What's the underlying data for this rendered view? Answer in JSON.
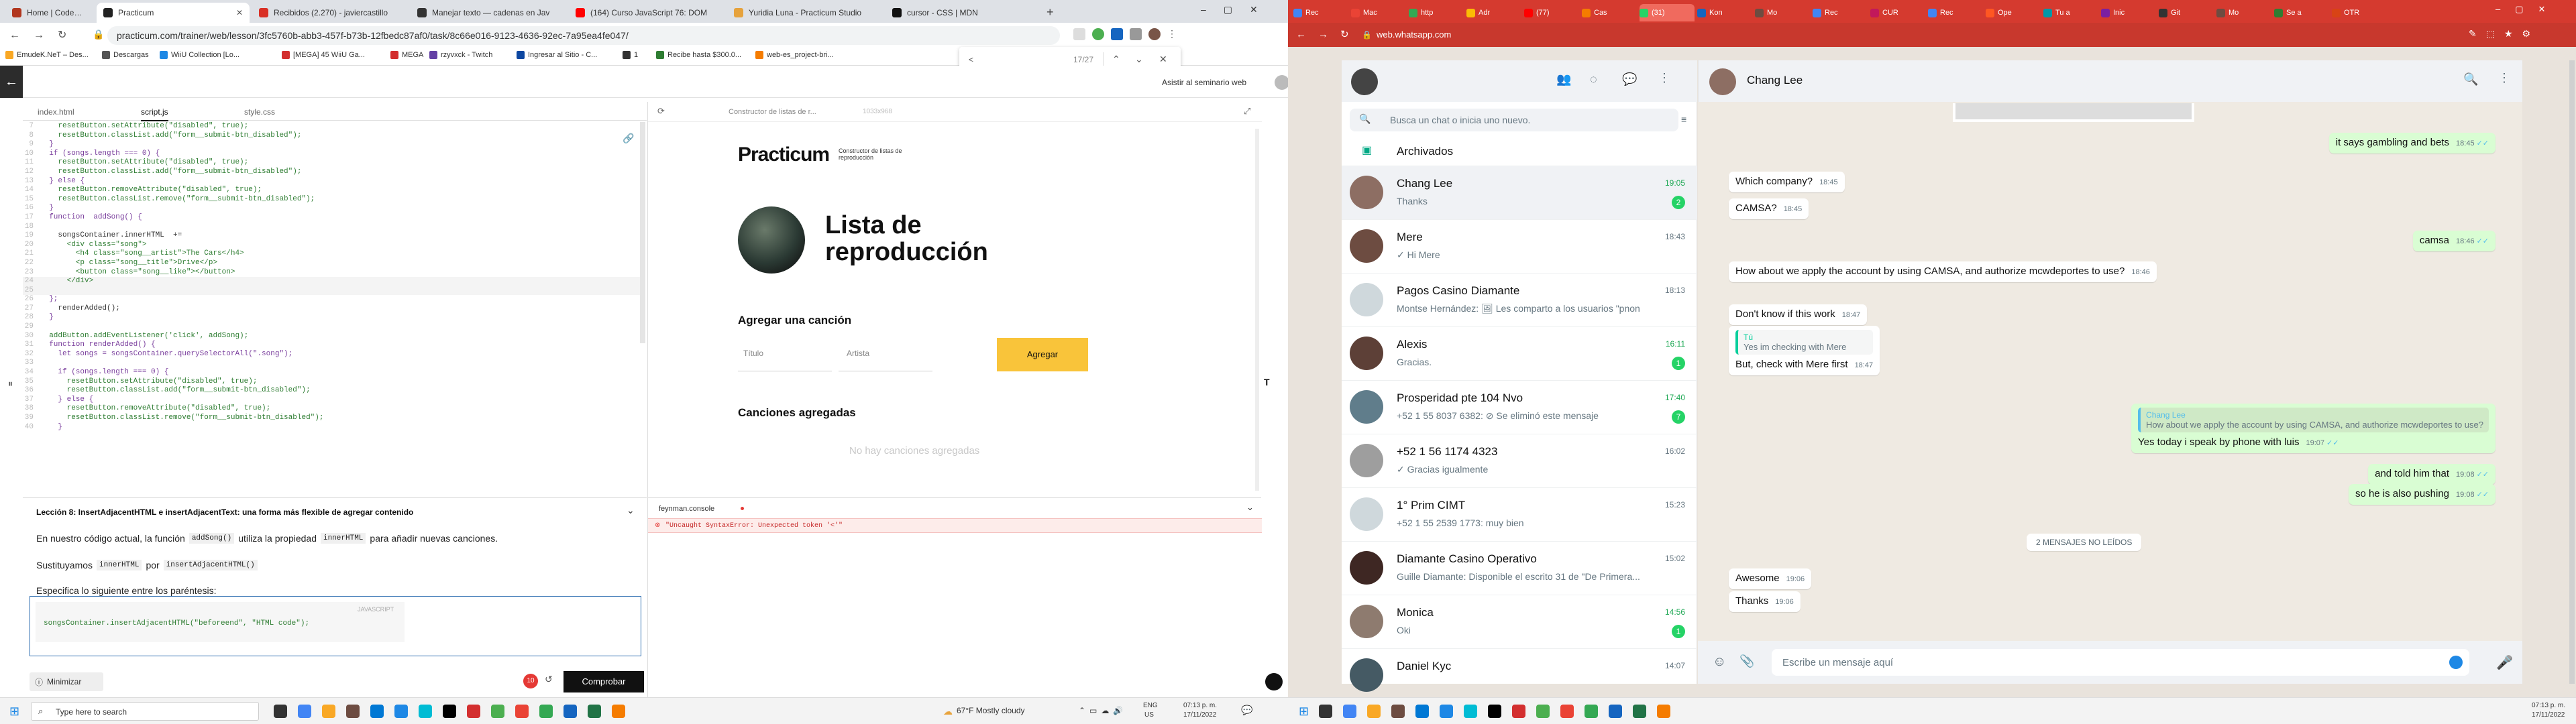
{
  "left_browser": {
    "tabs": [
      {
        "label": "Home | Codewars",
        "color": "#b1361e"
      },
      {
        "label": "Practicum",
        "color": "#222222"
      },
      {
        "label": "Recibidos (2.270) - javiercastillo",
        "color": "#d93025"
      },
      {
        "label": "Manejar texto — cadenas en Jav",
        "color": "#333333"
      },
      {
        "label": "(164) Curso JavaScript 76: DOM",
        "color": "#ff0000"
      },
      {
        "label": "Yuridia Luna - Practicum Studio",
        "color": "#e6a23c"
      },
      {
        "label": "cursor - CSS | MDN",
        "color": "#111111"
      }
    ],
    "url": "practicum.com/trainer/web/lesson/3fc5760b-abb3-457f-b73b-12fbedc87af0/task/8c66e016-9123-4636-92ec-7a95ea4fe047/",
    "bookmarks": [
      "EmudeK.NeT – Des...",
      "Descargas",
      "WiiU Collection [Lo...",
      "[MEGA] 45 WiiU Ga...",
      "MEGA",
      "rzyvxck - Twitch",
      "Ingresar al Sitio - C...",
      "1",
      "Recibe hasta $300.0...",
      "web-es_project-bri..."
    ],
    "find": {
      "query": "<",
      "count": "17/27"
    },
    "assist_link": "Asistir al seminario web",
    "editor_tabs": [
      "index.html",
      "script.js",
      "style.css"
    ],
    "code_lines": [
      {
        "n": "7",
        "t": "    resetButton.setAttribute(\"disabled\", true);"
      },
      {
        "n": "8",
        "t": "    resetButton.classList.add(\"form__submit-btn_disabled\");"
      },
      {
        "n": "9",
        "t": "  }"
      },
      {
        "n": "10",
        "t": "  if (songs.length === 0) {"
      },
      {
        "n": "11",
        "t": "    resetButton.setAttribute(\"disabled\", true);"
      },
      {
        "n": "12",
        "t": "    resetButton.classList.add(\"form__submit-btn_disabled\");"
      },
      {
        "n": "13",
        "t": "  } else {"
      },
      {
        "n": "14",
        "t": "    resetButton.removeAttribute(\"disabled\", true);"
      },
      {
        "n": "15",
        "t": "    resetButton.classList.remove(\"form__submit-btn_disabled\");"
      },
      {
        "n": "16",
        "t": "  }"
      },
      {
        "n": "17",
        "t": "  function  addSong() {"
      },
      {
        "n": "18",
        "t": ""
      },
      {
        "n": "19",
        "t": "    songsContainer.innerHTML  +="
      },
      {
        "n": "20",
        "t": "      <div class=\"song\">"
      },
      {
        "n": "21",
        "t": "        <h4 class=\"song__artist\">The Cars</h4>"
      },
      {
        "n": "22",
        "t": "        <p class=\"song__title\">Drive</p>"
      },
      {
        "n": "23",
        "t": "        <button class=\"song__like\"></button>"
      },
      {
        "n": "24",
        "t": "      </div>"
      },
      {
        "n": "25",
        "t": ""
      },
      {
        "n": "26",
        "t": "  };"
      },
      {
        "n": "27",
        "t": "    renderAdded();"
      },
      {
        "n": "28",
        "t": "  }"
      },
      {
        "n": "29",
        "t": ""
      },
      {
        "n": "30",
        "t": "  addButton.addEventListener('click', addSong);"
      },
      {
        "n": "31",
        "t": "  function renderAdded() {"
      },
      {
        "n": "32",
        "t": "    let songs = songsContainer.querySelectorAll(\".song\");"
      },
      {
        "n": "33",
        "t": ""
      },
      {
        "n": "34",
        "t": "    if (songs.length === 0) {"
      },
      {
        "n": "35",
        "t": "      resetButton.setAttribute(\"disabled\", true);"
      },
      {
        "n": "36",
        "t": "      resetButton.classList.add(\"form__submit-btn_disabled\");"
      },
      {
        "n": "37",
        "t": "    } else {"
      },
      {
        "n": "38",
        "t": "      resetButton.removeAttribute(\"disabled\", true);"
      },
      {
        "n": "39",
        "t": "      resetButton.classList.remove(\"form__submit-btn_disabled\");"
      },
      {
        "n": "40",
        "t": "    }"
      }
    ],
    "preview": {
      "bar_title": "Constructor de listas de r...",
      "bar_id": "1033x968",
      "brand": "Practicum",
      "brand_sub": "Constructor de listas de reproducción",
      "heading_1": "Lista de",
      "heading_2": "reproducción",
      "add_title": "Agregar una canción",
      "ph_title": "Título",
      "ph_artist": "Artista",
      "add_button": "Agregar",
      "added_title": "Canciones agregadas",
      "empty": "No hay canciones agregadas"
    },
    "lesson": {
      "title": "Lección 8: InsertAdjacentHTML e insertAdjacentText: una forma más flexible de agregar contenido",
      "p1_a": "En nuestro código actual, la función",
      "p1_code1": "addSong()",
      "p1_b": "utiliza la propiedad",
      "p1_code2": "innerHTML",
      "p1_c": "para añadir nuevas canciones.",
      "p2_a": "Sustituyamos",
      "p2_code1": "innerHTML",
      "p2_b": "por",
      "p2_code2": "insertAdjacentHTML()",
      "p3": "Especifica lo siguiente entre los paréntesis:",
      "code_lang": "JAVASCRIPT",
      "code": "songsContainer.insertAdjacentHTML(\"beforeend\", \"HTML code\");",
      "minimize": "Minimizar",
      "check": "Comprobar",
      "badge": "10"
    },
    "console": {
      "title": "feynman.console",
      "error": "\"Uncaught SyntaxError: Unexpected token '<'\""
    }
  },
  "right_browser": {
    "tabs": [
      "Rec",
      "Mac",
      "http",
      "Adr",
      "(77)",
      "Cas",
      "(31)",
      "Kon",
      "Mo",
      "Rec",
      "CUR",
      "Rec",
      "Ope",
      "Tu a",
      "Inic",
      "Git",
      "Mo",
      "Se a",
      "OTR"
    ],
    "url": "web.whatsapp.com",
    "search_placeholder": "Busca un chat o inicia uno nuevo.",
    "archived": "Archivados",
    "chats": [
      {
        "name": "Chang Lee",
        "preview": "Thanks",
        "time": "19:05",
        "badge": "2",
        "color": "#8d6e63"
      },
      {
        "name": "Mere",
        "preview": "✓ Hi Mere",
        "time": "18:43",
        "badge": "",
        "color": "#6d4c41"
      },
      {
        "name": "Pagos Casino Diamante",
        "preview": "Montse Hernández: 🖼 Les comparto a los usuarios \"pnon",
        "time": "18:13",
        "badge": "",
        "color": "#cfd8dc"
      },
      {
        "name": "Alexis",
        "preview": "Gracias.",
        "time": "16:11",
        "badge": "1",
        "color": "#5d4037"
      },
      {
        "name": "Prosperidad pte 104 Nvo",
        "preview": "+52 1 55 8037 6382: ⊘ Se eliminó este mensaje",
        "time": "17:40",
        "badge": "7",
        "color": "#607d8b"
      },
      {
        "name": "+52 1 56 1174 4323",
        "preview": "✓ Gracias igualmente",
        "time": "16:02",
        "badge": "",
        "color": "#9e9e9e"
      },
      {
        "name": "1° Prim CIMT",
        "preview": "+52 1 55 2539 1773: muy bien",
        "time": "15:23",
        "badge": "",
        "color": "#cfd8dc"
      },
      {
        "name": "Diamante Casino Operativo",
        "preview": "Guille Diamante: Disponible el escrito 31 de \"De Primera...",
        "time": "15:02",
        "badge": "",
        "color": "#3e2723"
      },
      {
        "name": "Monica",
        "preview": "Oki",
        "time": "14:56",
        "badge": "1",
        "color": "#8e7b6f"
      },
      {
        "name": "Daniel Kyc",
        "preview": "",
        "time": "14:07",
        "badge": "",
        "color": "#455a64"
      }
    ],
    "header_name": "Chang Lee",
    "messages": [
      {
        "side": "out",
        "text": "it says gambling and bets",
        "time": "18:45"
      },
      {
        "side": "in",
        "text": "Which company?",
        "time": "18:45"
      },
      {
        "side": "in",
        "text": "CAMSA?",
        "time": "18:45"
      },
      {
        "side": "out",
        "text": "camsa",
        "time": "18:46"
      },
      {
        "side": "in",
        "text": "How about we apply the account by using CAMSA, and authorize mcwdeportes to use?",
        "time": "18:46"
      },
      {
        "side": "in",
        "text": "Don't know if this work",
        "time": "18:47"
      },
      {
        "side": "in",
        "text": "But, check with Mere first",
        "time": "18:47",
        "quote_name": "Tú",
        "quote_text": "Yes im checking with Mere"
      },
      {
        "side": "out",
        "text": "Yes today i speak by phone with luis",
        "time": "19:07",
        "quote_name": "Chang Lee",
        "quote_text": "How about we apply the account by using CAMSA, and authorize mcwdeportes to use?"
      },
      {
        "side": "out",
        "text": "and told him that",
        "time": "19:08"
      },
      {
        "side": "out",
        "text": "so he is also pushing",
        "time": "19:08"
      },
      {
        "side": "in",
        "text": "Awesome",
        "time": "19:06"
      },
      {
        "side": "in",
        "text": "Thanks",
        "time": "19:06"
      }
    ],
    "unread_divider": "2 MENSAJES NO LEÍDOS",
    "compose_placeholder": "Escribe un mensaje aquí"
  },
  "taskbar": {
    "search_placeholder": "Type here to search",
    "weather": "67°F  Mostly cloudy",
    "lang1": "ENG",
    "lang2": "US",
    "time": "07:13 p. m.",
    "date": "17/11/2022",
    "time_r": "07:13 p. m.",
    "date_r": "17/11/2022"
  }
}
